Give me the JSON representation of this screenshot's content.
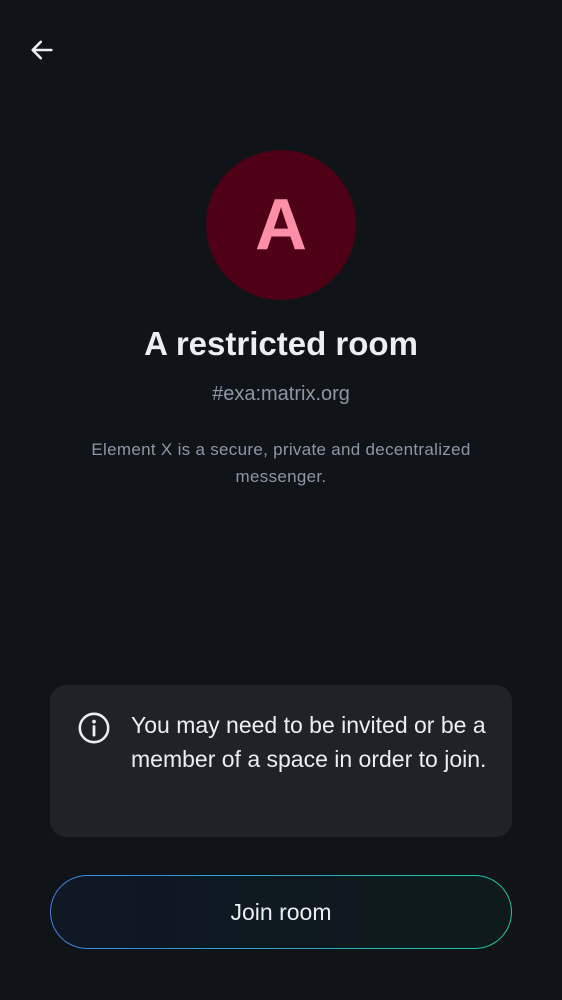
{
  "header": {
    "back_icon": "arrow-left-icon"
  },
  "room": {
    "avatar_letter": "A",
    "avatar_bg": "#4f0017",
    "avatar_fg": "#ff8fa8",
    "name": "A restricted room",
    "alias": "#exa:matrix.org",
    "topic": "Element X is a secure, private and decentralized messenger."
  },
  "notice": {
    "icon": "info-icon",
    "text": "You may need to be invited or be a member of a space in order to join."
  },
  "actions": {
    "join_label": "Join room",
    "gradient_start": "#3a86e8",
    "gradient_end": "#1ec9a0"
  }
}
